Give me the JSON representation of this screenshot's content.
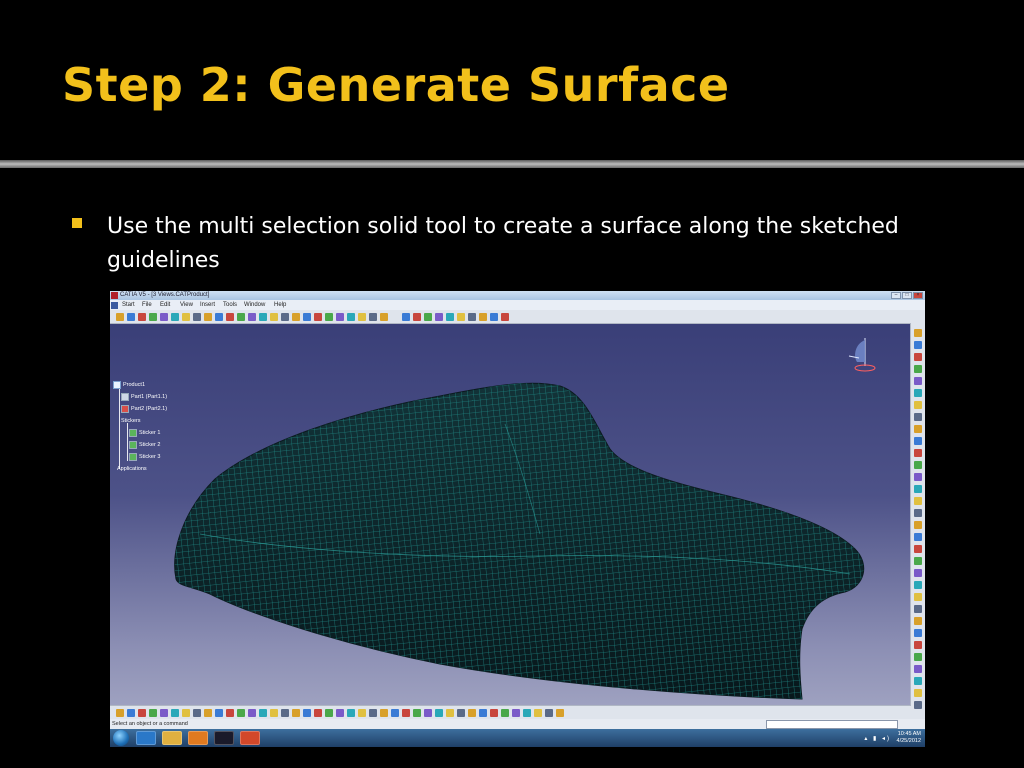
{
  "slide": {
    "title": "Step 2: Generate Surface",
    "bullet": "Use the multi selection solid tool to create a surface along the sketched guidelines"
  },
  "colors": {
    "title": "#f2c01b",
    "bullet": "#f2c01b",
    "background": "#000000",
    "viewport": "#4a4f85",
    "mesh": "#1f8a86",
    "surface": "#0c2226"
  },
  "app": {
    "window_title": "CATIA V5 - [3 Views.CATProduct]",
    "window_buttons": [
      "minimize",
      "maximize",
      "close"
    ],
    "menu": [
      "Start",
      "File",
      "Edit",
      "View",
      "Insert",
      "Tools",
      "Window",
      "Help"
    ],
    "tree": {
      "root": "Product1",
      "parts": [
        "Part1 (Part1.1)",
        "Part2 (Part2.1)"
      ],
      "stickers_label": "Stickers",
      "stickers": [
        "Sticker 1",
        "Sticker 2",
        "Sticker 3"
      ],
      "applications": "Applications"
    },
    "status_text": "Select an object or a command",
    "brand": "CATIA"
  },
  "taskbar": {
    "apps": [
      "internet-explorer-icon",
      "folder-icon",
      "media-player-icon",
      "catia-icon",
      "powerpoint-icon"
    ],
    "time": "10:45 AM",
    "date": "4/25/2012"
  }
}
